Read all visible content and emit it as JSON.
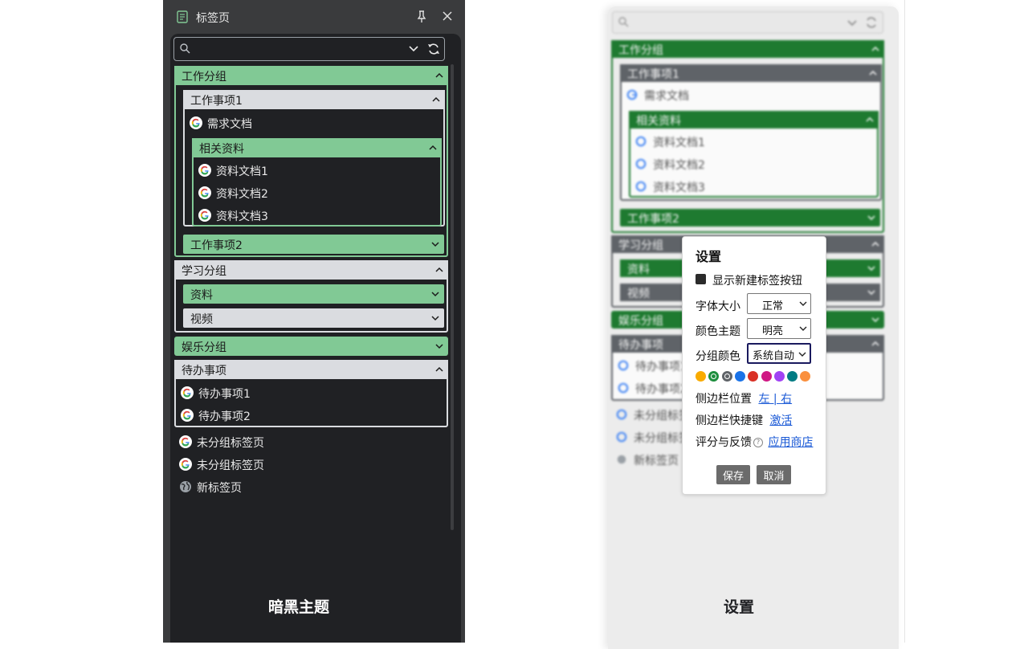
{
  "dark": {
    "header": {
      "title": "标签页"
    },
    "search": {
      "placeholder": ""
    },
    "groups": {
      "work": {
        "label": "工作分组",
        "items": {
          "task1": {
            "label": "工作事项1",
            "tab": "需求文档",
            "sub": {
              "label": "相关资料",
              "tabs": [
                "资料文档1",
                "资料文档2",
                "资料文档3"
              ]
            }
          },
          "task2": {
            "label": "工作事项2"
          }
        }
      },
      "study": {
        "label": "学习分组",
        "items": [
          "资料",
          "视频"
        ]
      },
      "fun": {
        "label": "娱乐分组"
      },
      "todo": {
        "label": "待办事项",
        "tabs": [
          "待办事项1",
          "待办事项2"
        ]
      }
    },
    "ungrouped": [
      "未分组标签页",
      "未分组标签页",
      "新标签页"
    ],
    "caption": "暗黑主题"
  },
  "light": {
    "groups": {
      "work": "工作分组",
      "task1": "工作事项1",
      "task1_tab": "需求文档",
      "sub": "相关资料",
      "sub_tabs": [
        "资料文档1",
        "资料文档2",
        "资料文档3"
      ],
      "task2": "工作事项2",
      "study": "学习分组",
      "study_items": [
        "资料",
        "视频"
      ],
      "fun": "娱乐分组",
      "todo": "待办事项",
      "todo_tabs": [
        "待办事项1",
        "待办事项2"
      ]
    },
    "ungrouped": [
      "未分组标签页",
      "未分组标签页",
      "新标签页"
    ]
  },
  "settings": {
    "title": "设置",
    "show_new_tab_button": "显示新建标签按钮",
    "font_size_label": "字体大小",
    "font_size_value": "正常",
    "theme_label": "颜色主题",
    "theme_value": "明亮",
    "group_color_label": "分组颜色",
    "group_color_value": "系统自动",
    "swatch_colors": [
      "#f9ab00",
      "#1e8e3e",
      "#5f6368",
      "#1a73e8",
      "#d93025",
      "#d01884",
      "#a142f4",
      "#007b83",
      "#fa903e"
    ],
    "sidebar_pos_label": "侧边栏位置",
    "sidebar_pos_left": "左",
    "sidebar_pos_sep": " | ",
    "sidebar_pos_right": "右",
    "shortcut_label": "侧边栏快捷键",
    "shortcut_link": "激活",
    "feedback_label": "评分与反馈",
    "feedback_link": "应用商店",
    "save": "保存",
    "cancel": "取消"
  },
  "caption_right": "设置",
  "colors": {
    "dark_bg": "#202124",
    "dark_frame": "#3a3b3d",
    "green_header": "#81c995",
    "gray_header": "#dadce0",
    "light_green_header": "#1e7a30",
    "light_gray_header": "#5f6368",
    "link": "#1a59d6"
  }
}
